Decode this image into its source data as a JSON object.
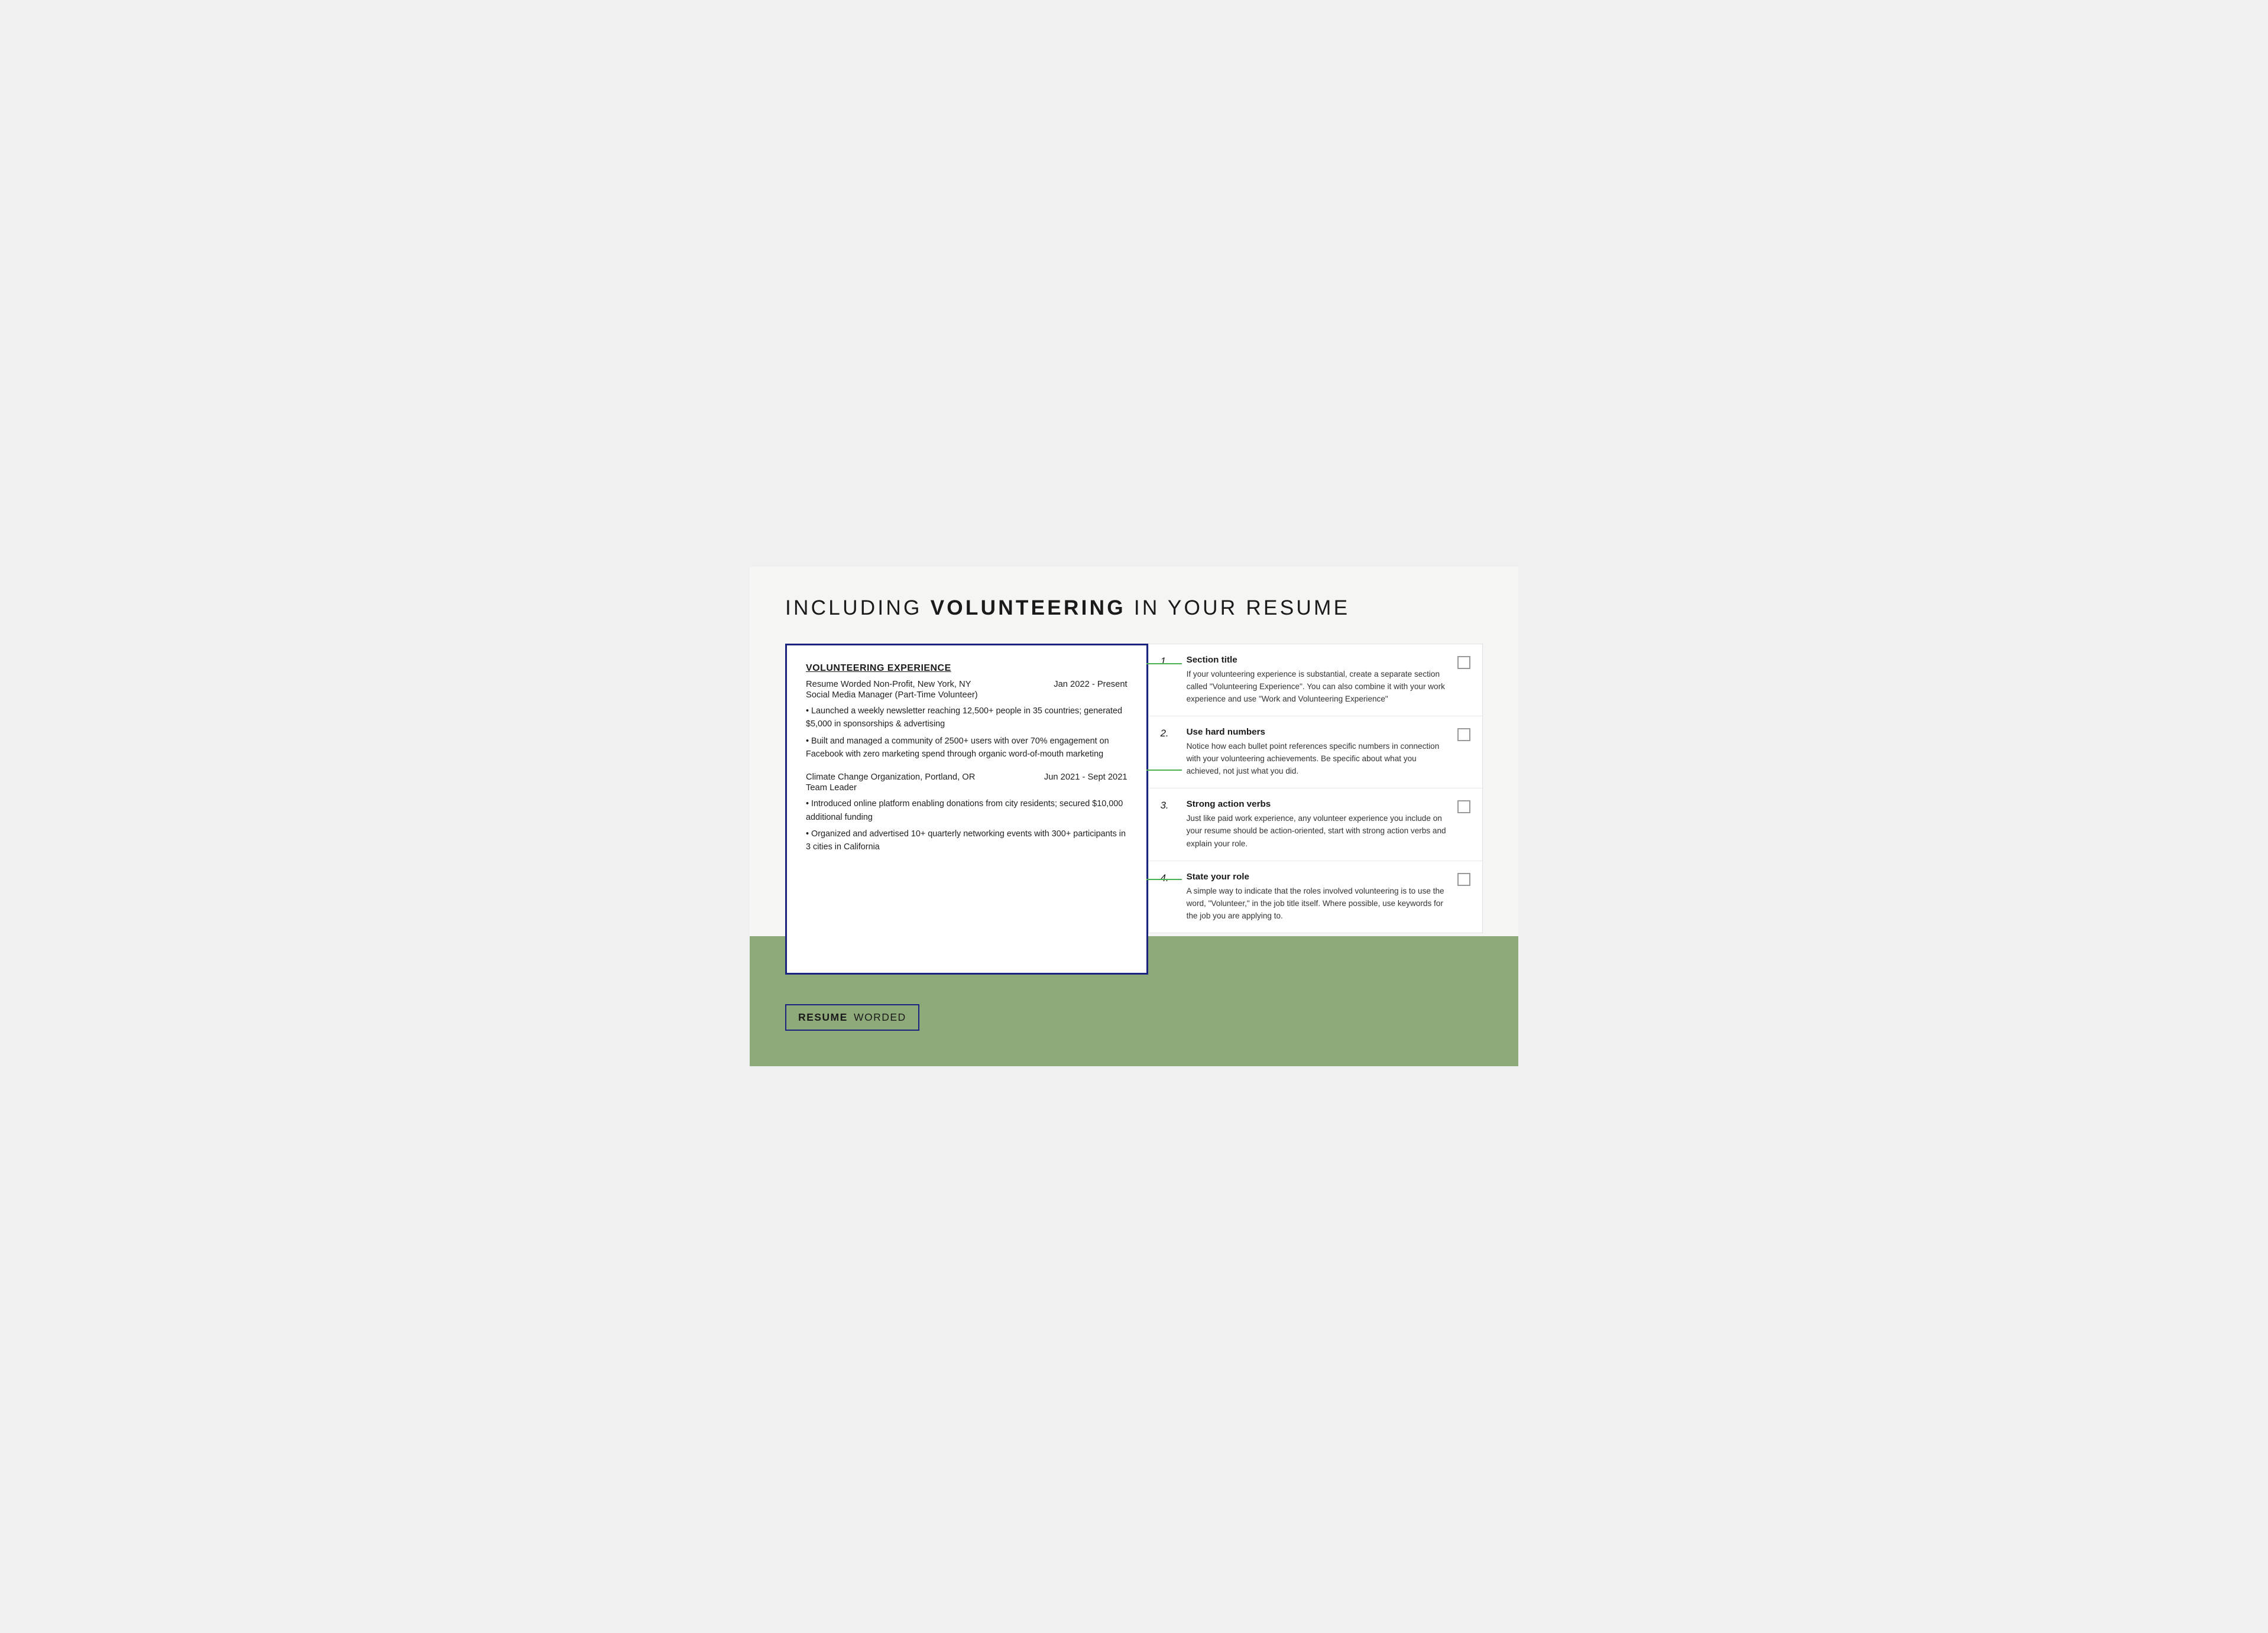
{
  "page": {
    "title_part1": "INCLUDING ",
    "title_bold": "VOLUNTEERING",
    "title_part2": " IN YOUR RESUME"
  },
  "resume": {
    "section_heading": "VOLUNTEERING EXPERIENCE",
    "entry1": {
      "org": "Resume Worded Non-Profit, New York, NY",
      "dates": "Jan 2022 - Present",
      "role": "Social Media Manager (Part-Time Volunteer)",
      "bullets": [
        "• Launched a weekly newsletter reaching 12,500+ people in 35 countries; generated $5,000 in sponsorships & advertising",
        "• Built and managed a community of 2500+ users with over 70% engagement on Facebook with zero marketing spend through organic word-of-mouth marketing"
      ]
    },
    "entry2": {
      "org": "Climate Change Organization, Portland, OR",
      "dates": "Jun 2021 - Sept 2021",
      "role": "Team Leader",
      "bullets": [
        "• Introduced online platform enabling donations from city residents; secured $10,000 additional funding",
        "• Organized and advertised 10+ quarterly networking events with 300+ participants in 3 cities in California"
      ]
    }
  },
  "tips": [
    {
      "number": "1.",
      "title": "Section title",
      "text": "If your volunteering experience is substantial, create a separate section called \"Volunteering Experience\". You can also combine it with your work experience and use \"Work and Volunteering Experience\""
    },
    {
      "number": "2.",
      "title": "Use hard numbers",
      "text": "Notice how each bullet point references specific numbers in connection with your volunteering achievements. Be specific about what you achieved, not just what you did."
    },
    {
      "number": "3.",
      "title": "Strong action verbs",
      "text": "Just like paid work experience, any volunteer experience you include on your resume should be action-oriented, start with strong action verbs and explain your role."
    },
    {
      "number": "4.",
      "title": "State your role",
      "text": "A simple way to indicate that the roles involved volunteering is to use the word, \"Volunteer,\" in the job title itself. Where possible, use keywords for the job you are applying to."
    }
  ],
  "branding": {
    "resume": "RESUME",
    "worded": "WORDED"
  }
}
